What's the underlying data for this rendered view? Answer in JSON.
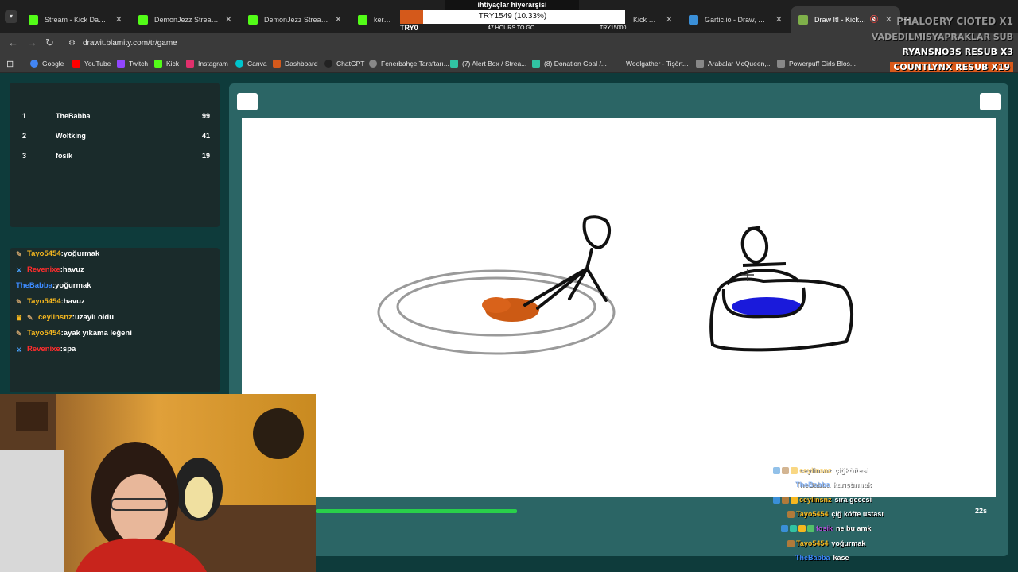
{
  "browser": {
    "tabs": [
      {
        "label": "Stream - Kick Dashboard",
        "color": "#53fc18"
      },
      {
        "label": "DemonJezz Stream - Wat",
        "color": "#53fc18"
      },
      {
        "label": "DemonJezz Stream - Wat",
        "color": "#53fc18"
      },
      {
        "label": "keremturke",
        "color": "#53fc18"
      },
      {
        "label": "Kick Strea",
        "color": "#53fc18"
      },
      {
        "label": "Gartic.io - Draw, Guess, W",
        "color": "#3a8fd8"
      },
      {
        "label": "Draw It! - Kick Yayınla",
        "color": "#7fb04a"
      }
    ],
    "url": "drawit.blamity.com/tr/game",
    "bookmarks": [
      {
        "label": "Google",
        "color": "#4285f4"
      },
      {
        "label": "YouTube",
        "color": "#ff0000"
      },
      {
        "label": "Twitch",
        "color": "#9146ff"
      },
      {
        "label": "Kick",
        "color": "#53fc18"
      },
      {
        "label": "Instagram",
        "color": "#e1306c"
      },
      {
        "label": "Canva",
        "color": "#00c4cc"
      },
      {
        "label": "Dashboard",
        "color": "#d4591b"
      },
      {
        "label": "ChatGPT",
        "color": "#222222"
      },
      {
        "label": "Fenerbahçe Taraftarı...",
        "color": "#888888"
      },
      {
        "label": "(7) Alert Box / Strea...",
        "color": "#31c3a2"
      },
      {
        "label": "(8) Donation Goal /...",
        "color": "#31c3a2"
      },
      {
        "label": "Woolgather - Tişört...",
        "color": "#3a3a3a"
      },
      {
        "label": "Arabalar McQueen,...",
        "color": "#888888"
      },
      {
        "label": "Powerpuff Girls Blos...",
        "color": "#888888"
      }
    ]
  },
  "goal": {
    "title": "ihtiyaçlar hiyerarşisi",
    "amount_text": "TRY1549 (10.33%)",
    "progress": 0.1033,
    "start": "TRY0",
    "remaining": "47 HOURS TO GO",
    "target": "TRY15000"
  },
  "alerts": [
    {
      "text": "PHALOERY CIOTED X1",
      "style": "faint"
    },
    {
      "text": "VADEDILMISYAPRAKLAR SUB",
      "style": "faint"
    },
    {
      "text": "RYANSNO3S RESUB X3",
      "style": "normal"
    },
    {
      "text": "COUNTLYNX RESUB X19",
      "style": "boxed"
    }
  ],
  "scoreboard": [
    {
      "rank": "1",
      "name": "TheBabba",
      "points": "99"
    },
    {
      "rank": "2",
      "name": "Woltking",
      "points": "41"
    },
    {
      "rank": "3",
      "name": "fosik",
      "points": "19"
    }
  ],
  "chat": [
    {
      "user": "Tayo5454",
      "message": "yoğurmak",
      "color": "#f5b71f",
      "icon": "pencil"
    },
    {
      "user": "Revenixe",
      "message": "havuz",
      "color": "#ff2d2d",
      "icon": "sword"
    },
    {
      "user": "TheBabba",
      "message": "yoğurmak",
      "color": "#3d8bff",
      "icon": ""
    },
    {
      "user": "Tayo5454",
      "message": "havuz",
      "color": "#f5b71f",
      "icon": "pencil"
    },
    {
      "user": "ceylinsnz",
      "message": "uzaylı oldu",
      "color": "#f5b71f",
      "icon": "crown"
    },
    {
      "user": "Tayo5454",
      "message": "ayak yıkama leğeni",
      "color": "#f5b71f",
      "icon": "pencil"
    },
    {
      "user": "Revenixe",
      "message": "spa",
      "color": "#ff2d2d",
      "icon": "sword"
    }
  ],
  "timer": {
    "seconds_left": "22s",
    "progress": 0.27
  },
  "overlay_chat": [
    {
      "user": "ceylinsnz",
      "message": "çiğköftesi",
      "color": "#f5b71f",
      "faint": true
    },
    {
      "user": "TheBabba",
      "message": "karıştırmak",
      "color": "#3d8bff",
      "faint": true
    },
    {
      "user": "ceylinsnz",
      "message": "sıra gecesi",
      "color": "#f5b71f",
      "faint": false
    },
    {
      "user": "Tayo5454",
      "message": "çiğ köfte ustası",
      "color": "#f5b71f",
      "faint": false
    },
    {
      "user": "fosik",
      "message": "ne bu amk",
      "color": "#b04ed8",
      "faint": false
    },
    {
      "user": "Tayo5454",
      "message": "yoğurmak",
      "color": "#f5b71f",
      "faint": false
    },
    {
      "user": "TheBabba",
      "message": "kase",
      "color": "#3d8bff",
      "faint": false
    }
  ]
}
